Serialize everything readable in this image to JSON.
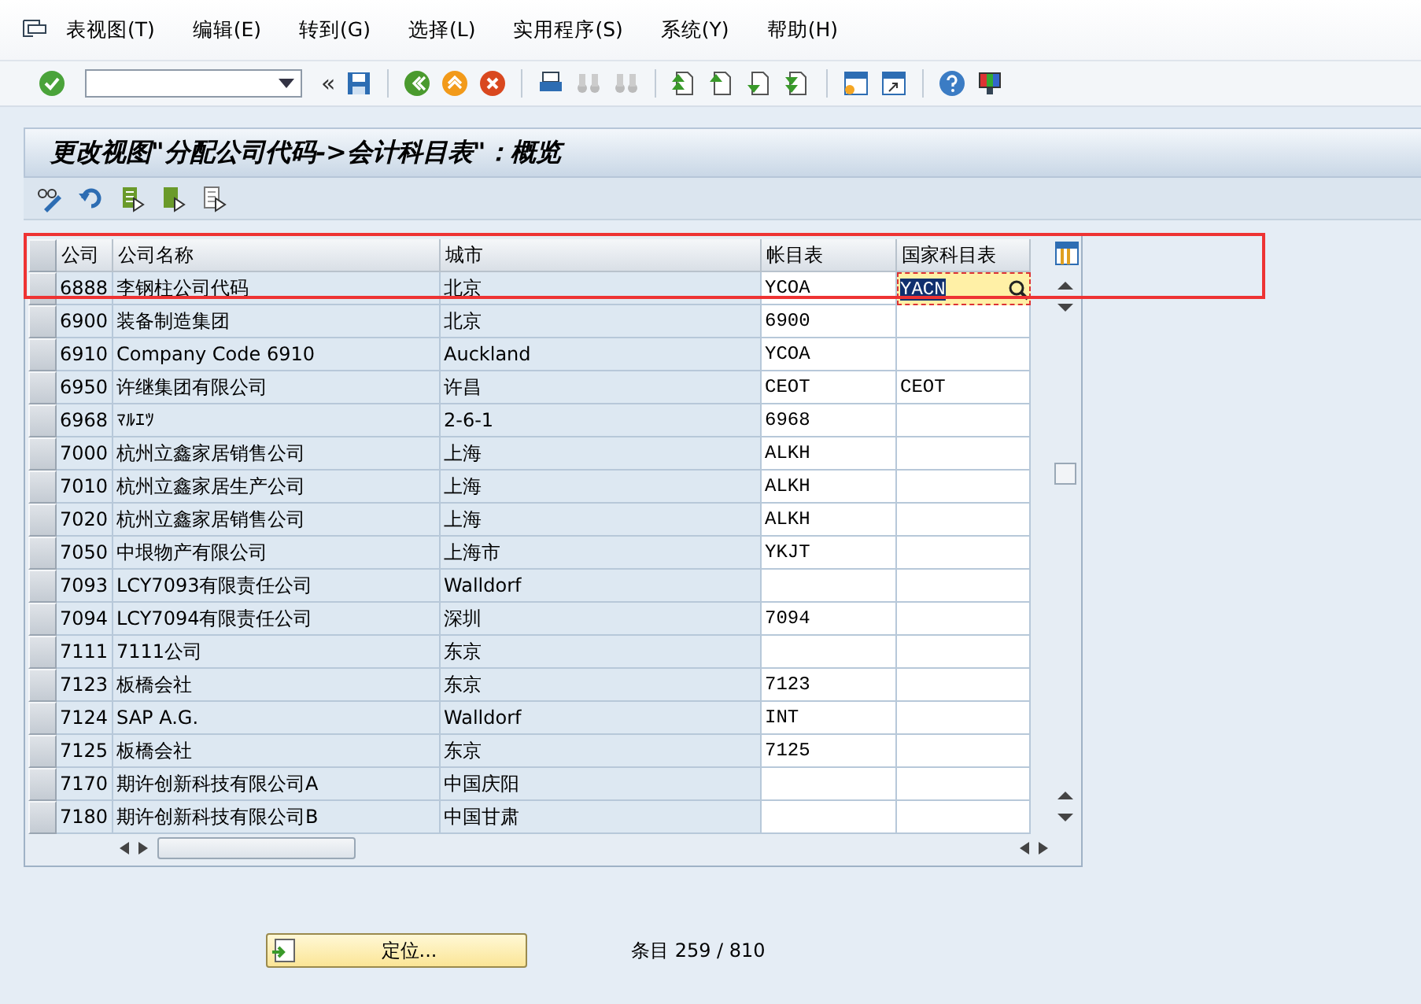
{
  "menu_bar": {
    "items": [
      "表视图(T)",
      "编辑(E)",
      "转到(G)",
      "选择(L)",
      "实用程序(S)",
      "系统(Y)",
      "帮助(H)"
    ]
  },
  "toolbar": {
    "back_label": "«"
  },
  "screen_title": "更改视图\"分配公司代码->会计科目表\"：概览",
  "table": {
    "columns": [
      "公司",
      "公司名称",
      "城市",
      "帐目表",
      "国家科目表"
    ],
    "rows": [
      {
        "cells": [
          "6888",
          "李钢柱公司代码",
          "北京",
          "YCOA",
          "YACN"
        ],
        "editing": true
      },
      {
        "cells": [
          "6900",
          "装备制造集团",
          "北京",
          "6900",
          ""
        ],
        "editing": false
      },
      {
        "cells": [
          "6910",
          "Company Code 6910",
          "Auckland",
          "YCOA",
          ""
        ],
        "editing": false
      },
      {
        "cells": [
          "6950",
          "许继集团有限公司",
          "许昌",
          "CEOT",
          "CEOT"
        ],
        "editing": false
      },
      {
        "cells": [
          "6968",
          "ﾏﾙｴﾂ",
          "2-6-1",
          "6968",
          ""
        ],
        "editing": false
      },
      {
        "cells": [
          "7000",
          "杭州立鑫家居销售公司",
          "上海",
          "ALKH",
          ""
        ],
        "editing": false
      },
      {
        "cells": [
          "7010",
          "杭州立鑫家居生产公司",
          "上海",
          "ALKH",
          ""
        ],
        "editing": false
      },
      {
        "cells": [
          "7020",
          "杭州立鑫家居销售公司",
          "上海",
          "ALKH",
          ""
        ],
        "editing": false
      },
      {
        "cells": [
          "7050",
          "中垠物产有限公司",
          "上海市",
          "YKJT",
          ""
        ],
        "editing": false
      },
      {
        "cells": [
          "7093",
          "LCY7093有限责任公司",
          "Walldorf",
          "",
          ""
        ],
        "editing": false
      },
      {
        "cells": [
          "7094",
          "LCY7094有限责任公司",
          "深圳",
          "7094",
          ""
        ],
        "editing": false
      },
      {
        "cells": [
          "7111",
          "7111公司",
          "东京",
          "",
          ""
        ],
        "editing": false
      },
      {
        "cells": [
          "7123",
          "板橋会社",
          "东京",
          "7123",
          ""
        ],
        "editing": false
      },
      {
        "cells": [
          "7124",
          "SAP A.G.",
          "Walldorf",
          "INT",
          ""
        ],
        "editing": false
      },
      {
        "cells": [
          "7125",
          "板橋会社",
          "东京",
          "7125",
          ""
        ],
        "editing": false
      },
      {
        "cells": [
          "7170",
          "期许创新科技有限公司A",
          "中国庆阳",
          "",
          ""
        ],
        "editing": false
      },
      {
        "cells": [
          "7180",
          "期许创新科技有限公司B",
          "中国甘肃",
          "",
          ""
        ],
        "editing": false
      }
    ]
  },
  "position_button": "定位...",
  "entry_counter": "条目 259 / 810"
}
